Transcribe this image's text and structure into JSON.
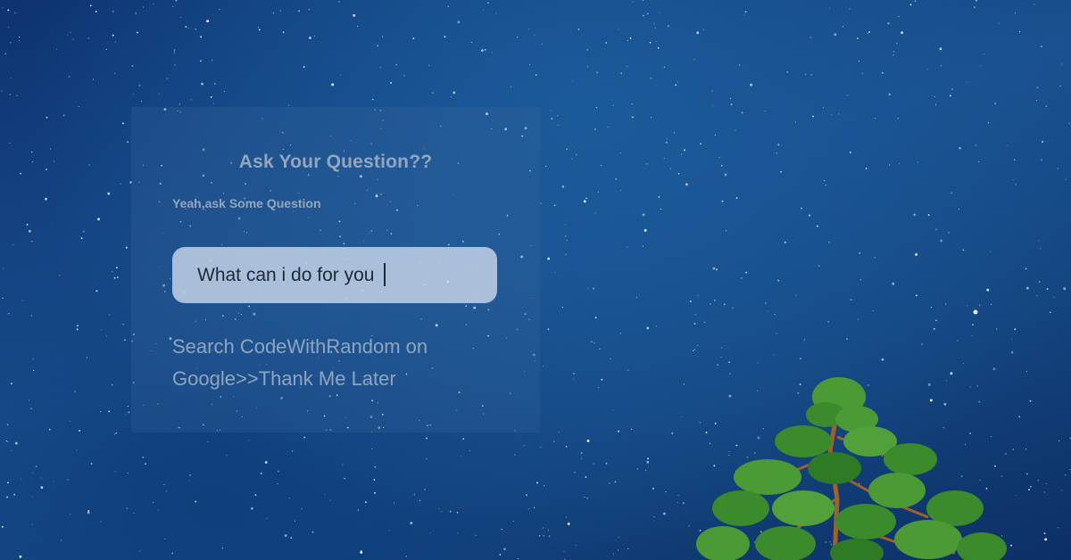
{
  "card": {
    "title": "Ask Your Question??",
    "subtitle": "Yeah,ask Some Question",
    "input_value": "What can i do for you",
    "footer_line1": "Search CodeWithRandom on",
    "footer_line2": "Google>>Thank Me Later"
  },
  "background": {
    "description_icon": "night-sky-stars",
    "tree_icon": "pine-tree-icon"
  },
  "colors": {
    "sky_dark": "#0d3370",
    "sky_mid": "#1a4f8e",
    "card_text": "#93a6bd",
    "input_bg": "#cddaeb",
    "tree_green": "#3d8a2e"
  }
}
